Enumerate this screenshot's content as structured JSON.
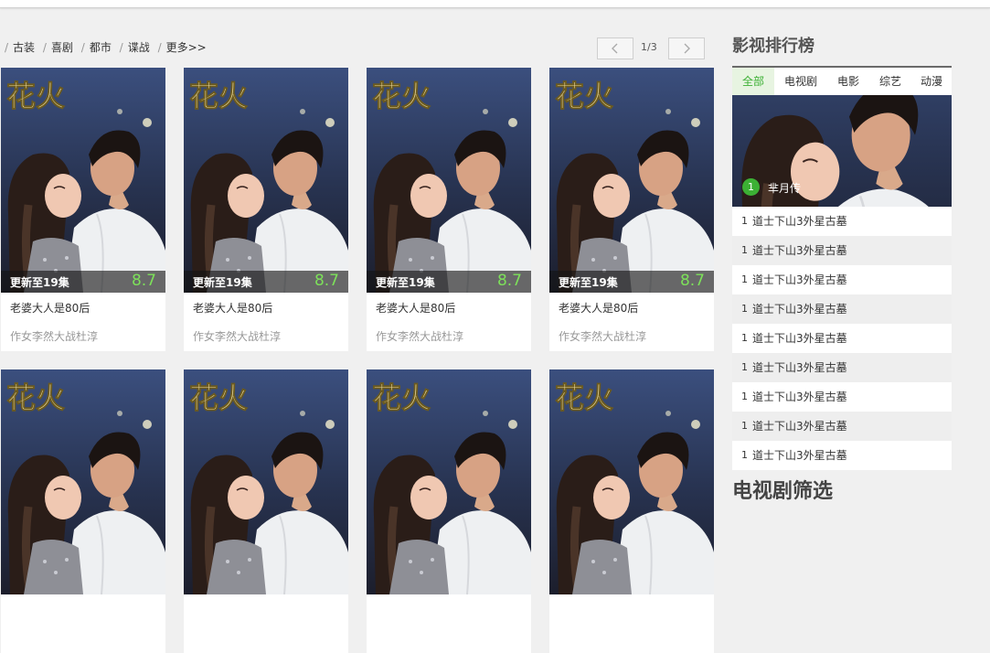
{
  "breadcrumb": {
    "items": [
      "古装",
      "喜剧",
      "都市",
      "谍战",
      "更多>>"
    ]
  },
  "pager": {
    "page": "1/3",
    "prev_icon": "chevron-left-icon",
    "next_icon": "chevron-right-icon"
  },
  "cards": [
    {
      "status": "更新至19集",
      "score": "8.7",
      "title": "老婆大人是80后",
      "subtitle": "作女李然大战杜淳",
      "poster_text": "花火"
    },
    {
      "status": "更新至19集",
      "score": "8.7",
      "title": "老婆大人是80后",
      "subtitle": "作女李然大战杜淳",
      "poster_text": "花火"
    },
    {
      "status": "更新至19集",
      "score": "8.7",
      "title": "老婆大人是80后",
      "subtitle": "作女李然大战杜淳",
      "poster_text": "花火"
    },
    {
      "status": "更新至19集",
      "score": "8.7",
      "title": "老婆大人是80后",
      "subtitle": "作女李然大战杜淳",
      "poster_text": "花火"
    },
    {
      "poster_text": "花火"
    },
    {
      "poster_text": "花火"
    },
    {
      "poster_text": "花火"
    },
    {
      "poster_text": "花火"
    }
  ],
  "ranking": {
    "heading": "影视排行榜",
    "tabs": [
      "全部",
      "电视剧",
      "电影",
      "综艺",
      "动漫"
    ],
    "active_tab": 0,
    "hero": {
      "rank": "1",
      "name": "芈月传",
      "poster_text": "花火"
    },
    "rows": [
      {
        "rank": "1",
        "title": "道士下山3外星古墓"
      },
      {
        "rank": "1",
        "title": "道士下山3外星古墓"
      },
      {
        "rank": "1",
        "title": "道士下山3外星古墓"
      },
      {
        "rank": "1",
        "title": "道士下山3外星古墓"
      },
      {
        "rank": "1",
        "title": "道士下山3外星古墓"
      },
      {
        "rank": "1",
        "title": "道士下山3外星古墓"
      },
      {
        "rank": "1",
        "title": "道士下山3外星古墓"
      },
      {
        "rank": "1",
        "title": "道士下山3外星古墓"
      },
      {
        "rank": "1",
        "title": "道士下山3外星古墓"
      }
    ]
  },
  "next_section_heading": "电视剧筛选",
  "colors": {
    "accent_green": "#3cb034",
    "score_green": "#7de05a",
    "page_bg": "#f0f0f0"
  }
}
